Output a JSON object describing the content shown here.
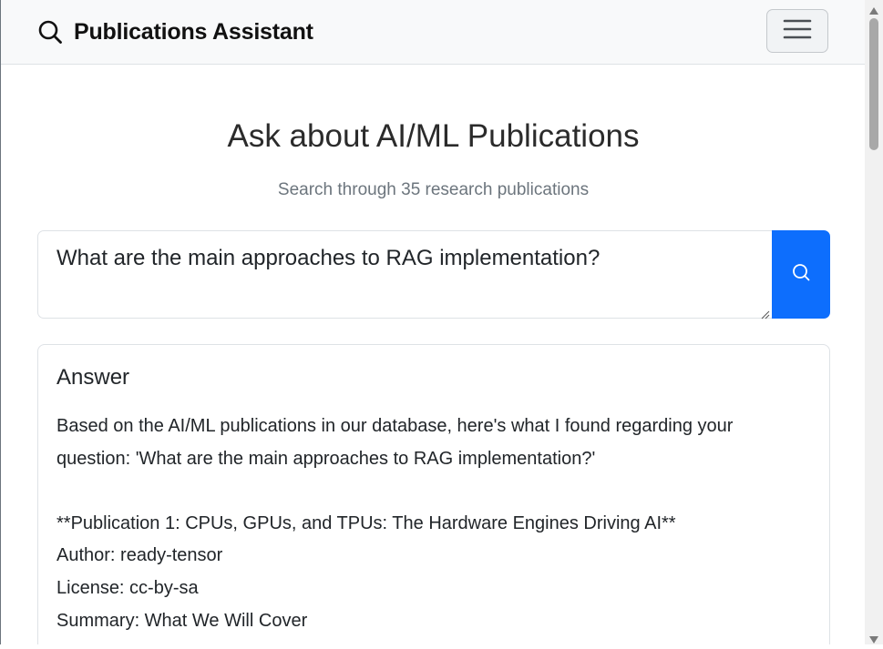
{
  "navbar": {
    "brand_title": "Publications Assistant",
    "brand_icon": "search-icon",
    "menu_icon": "hamburger-menu-icon"
  },
  "header": {
    "title": "Ask about AI/ML Publications",
    "subtitle": "Search through 35 research publications"
  },
  "search": {
    "question_value": "What are the main approaches to RAG implementation?",
    "submit_icon": "search-icon",
    "button_color": "#0d6efd"
  },
  "answer": {
    "heading": "Answer",
    "lines": [
      "Based on the AI/ML publications in our database, here's what I found regarding your",
      "question: 'What are the main approaches to RAG implementation?'",
      "",
      "**Publication 1: CPUs, GPUs, and TPUs: The Hardware Engines Driving AI**",
      "Author: ready-tensor",
      "License: cc-by-sa",
      "Summary: What We Will Cover"
    ]
  }
}
